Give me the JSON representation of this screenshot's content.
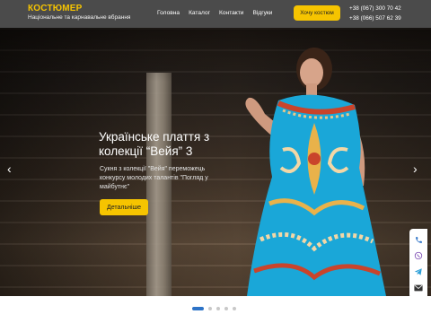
{
  "header": {
    "logo_title": "КОСТЮМЕР",
    "logo_subtitle": "Національне та карнавальне вбрання",
    "nav": [
      {
        "label": "Головна"
      },
      {
        "label": "Каталог"
      },
      {
        "label": "Контакти"
      },
      {
        "label": "Відгуки"
      }
    ],
    "cta_label": "Хочу костюм",
    "phones": [
      "+38 (067) 300 70 42",
      "+38 (066) 507 62 39"
    ]
  },
  "hero": {
    "title_line1": "Українське плаття з",
    "title_line2": "колекції “Вейя” 3",
    "description": "Сукня з колекції \"Вейя\" переможець конкурсу молодих талантів \"Погляд у майбутнє\"",
    "button_label": "Детальніше",
    "prev_arrow": "‹",
    "next_arrow": "›"
  },
  "contacts": {
    "icons": [
      "phone-icon",
      "viber-icon",
      "telegram-icon",
      "email-icon"
    ]
  },
  "carousel": {
    "dots": 5,
    "active_index": 0
  },
  "colors": {
    "accent": "#f6c400",
    "header_bg": "#4b4b4b",
    "dot_active": "#2d73c7",
    "dress_blue": "#1aa7d8"
  }
}
